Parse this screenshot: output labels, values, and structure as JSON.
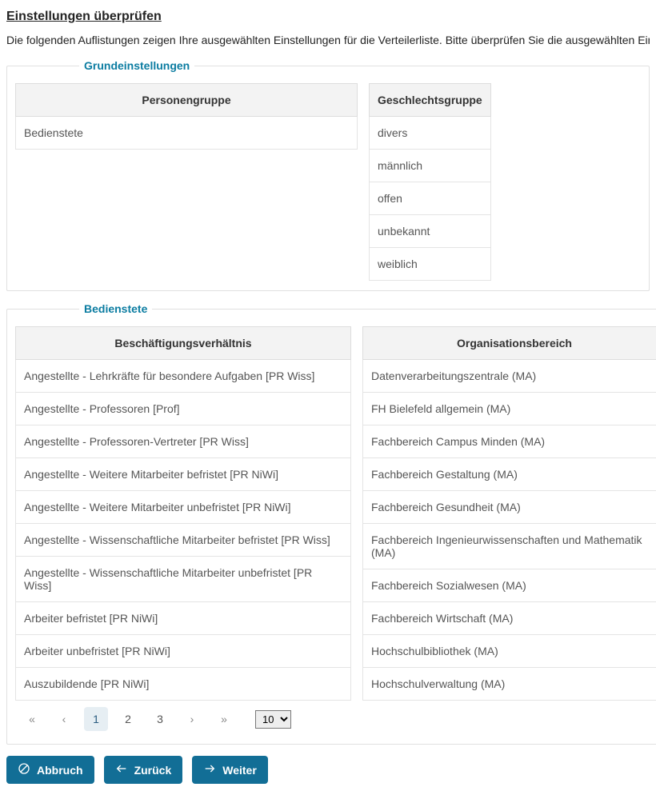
{
  "page": {
    "title": "Einstellungen überprüfen",
    "intro": "Die folgenden Auflistungen zeigen Ihre ausgewählten Einstellungen für die Verteilerliste. Bitte überprüfen Sie die ausgewählten Einstellun"
  },
  "sections": {
    "grund": {
      "legend": "Grundeinstellungen",
      "personengruppe": {
        "header": "Personengruppe",
        "rows": [
          "Bedienstete"
        ]
      },
      "geschlecht": {
        "header": "Geschlechtsgruppe",
        "rows": [
          "divers",
          "männlich",
          "offen",
          "unbekannt",
          "weiblich"
        ]
      }
    },
    "bedienstete": {
      "legend": "Bedienstete",
      "beschaeftigung": {
        "header": "Beschäftigungsverhältnis",
        "rows": [
          "Angestellte - Lehrkräfte für besondere Aufgaben [PR Wiss]",
          "Angestellte - Professoren [Prof]",
          "Angestellte - Professoren-Vertreter [PR Wiss]",
          "Angestellte - Weitere Mitarbeiter befristet [PR NiWi]",
          "Angestellte - Weitere Mitarbeiter unbefristet [PR NiWi]",
          "Angestellte - Wissenschaftliche Mitarbeiter befristet [PR Wiss]",
          "Angestellte - Wissenschaftliche Mitarbeiter unbefristet [PR Wiss]",
          "Arbeiter befristet [PR NiWi]",
          "Arbeiter unbefristet [PR NiWi]",
          "Auszubildende [PR NiWi]"
        ]
      },
      "organisation": {
        "header": "Organisationsbereich",
        "rows": [
          "Datenverarbeitungszentrale (MA)",
          "FH Bielefeld allgemein (MA)",
          "Fachbereich Campus Minden (MA)",
          "Fachbereich Gestaltung (MA)",
          "Fachbereich Gesundheit (MA)",
          "Fachbereich Ingenieurwissenschaften und Mathematik (MA)",
          "Fachbereich Sozialwesen (MA)",
          "Fachbereich Wirtschaft (MA)",
          "Hochschulbibliothek (MA)",
          "Hochschulverwaltung (MA)"
        ]
      },
      "paginator": {
        "pages": [
          "1",
          "2",
          "3"
        ],
        "active": "1",
        "page_size": "10"
      }
    }
  },
  "buttons": {
    "cancel": "Abbruch",
    "back": "Zurück",
    "next": "Weiter"
  }
}
